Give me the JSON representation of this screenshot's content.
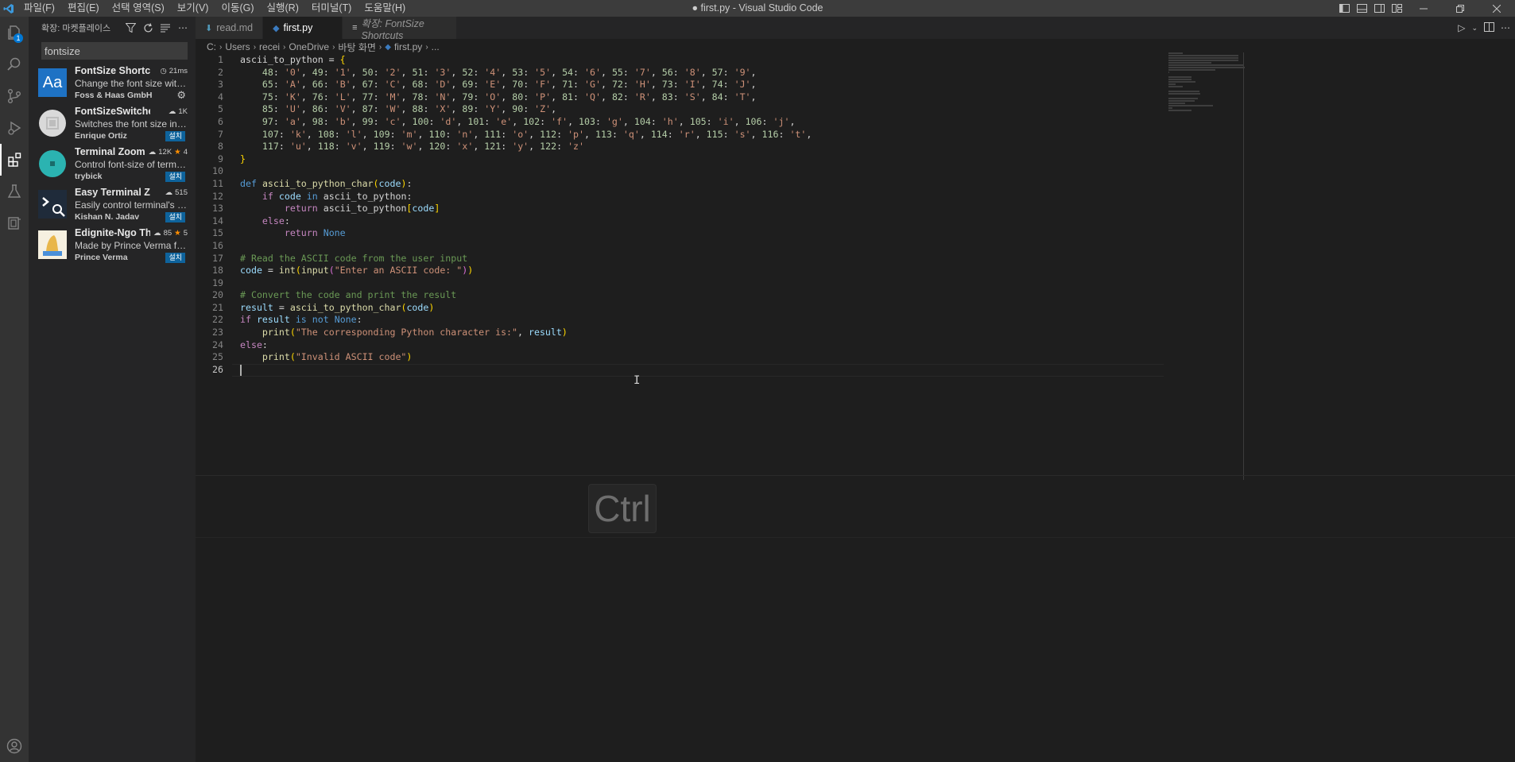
{
  "titlebar": {
    "menus": [
      "파일(F)",
      "편집(E)",
      "선택 영역(S)",
      "보기(V)",
      "이동(G)",
      "실행(R)",
      "터미널(T)",
      "도움말(H)"
    ],
    "window_title": "● first.py - Visual Studio Code"
  },
  "activity_bar": {
    "explorer_badge": "1"
  },
  "sidebar": {
    "header": "확장: 마켓플레이스",
    "search_value": "fontsize",
    "extensions": [
      {
        "name": "FontSize Shortcuts",
        "stats": "21ms",
        "description": "Change the font size with ke...",
        "publisher": "Foss & Haas GmbH",
        "action": "gear",
        "logo_text": "Aa"
      },
      {
        "name": "FontSizeSwitcher",
        "stats": "1K",
        "description": "Switches the font size in you...",
        "publisher": "Enrique Ortiz",
        "action": "설치"
      },
      {
        "name": "Terminal Zoom",
        "stats": "12K",
        "rating": "4",
        "description": "Control font-size of terminal",
        "publisher": "trybick",
        "action": "설치"
      },
      {
        "name": "Easy Terminal Zoom",
        "stats": "515",
        "description": "Easily control terminal's font...",
        "publisher": "Kishan N. Jadav",
        "action": "설치"
      },
      {
        "name": "Edignite-Ngo Th...",
        "stats": "85",
        "rating": "5",
        "description": "Made by Prince Verma for E...",
        "publisher": "Prince Verma",
        "action": "설치"
      }
    ]
  },
  "tabs": [
    {
      "label": "read.md",
      "active": false
    },
    {
      "label": "first.py",
      "active": true,
      "modified": true
    },
    {
      "label": "확장: FontSize Shortcuts",
      "active": false,
      "italic": true
    }
  ],
  "breadcrumb": [
    "C:",
    "Users",
    "recei",
    "OneDrive",
    "바탕 화면",
    "first.py",
    "..."
  ],
  "code_lines": [
    "ascii_to_python = {",
    "    48: '0', 49: '1', 50: '2', 51: '3', 52: '4', 53: '5', 54: '6', 55: '7', 56: '8', 57: '9',",
    "    65: 'A', 66: 'B', 67: 'C', 68: 'D', 69: 'E', 70: 'F', 71: 'G', 72: 'H', 73: 'I', 74: 'J',",
    "    75: 'K', 76: 'L', 77: 'M', 78: 'N', 79: 'O', 80: 'P', 81: 'Q', 82: 'R', 83: 'S', 84: 'T',",
    "    85: 'U', 86: 'V', 87: 'W', 88: 'X', 89: 'Y', 90: 'Z',",
    "    97: 'a', 98: 'b', 99: 'c', 100: 'd', 101: 'e', 102: 'f', 103: 'g', 104: 'h', 105: 'i', 106: 'j',",
    "    107: 'k', 108: 'l', 109: 'm', 110: 'n', 111: 'o', 112: 'p', 113: 'q', 114: 'r', 115: 's', 116: 't',",
    "    117: 'u', 118: 'v', 119: 'w', 120: 'x', 121: 'y', 122: 'z'",
    "}",
    "",
    "def ascii_to_python_char(code):",
    "    if code in ascii_to_python:",
    "        return ascii_to_python[code]",
    "    else:",
    "        return None",
    "",
    "# Read the ASCII code from the user input",
    "code = int(input(\"Enter an ASCII code: \"))",
    "",
    "# Convert the code and print the result",
    "result = ascii_to_python_char(code)",
    "if result is not None:",
    "    print(\"The corresponding Python character is:\", result)",
    "else:",
    "    print(\"Invalid ASCII code\")",
    ""
  ],
  "current_line": 26,
  "key_overlay": "Ctrl",
  "colors": {
    "accent": "#0078d4",
    "install_button": "#0e639c",
    "keyword": "#569cd6",
    "function": "#dcdcaa",
    "string": "#ce9178",
    "comment": "#6a9955",
    "variable": "#9cdcfe"
  }
}
